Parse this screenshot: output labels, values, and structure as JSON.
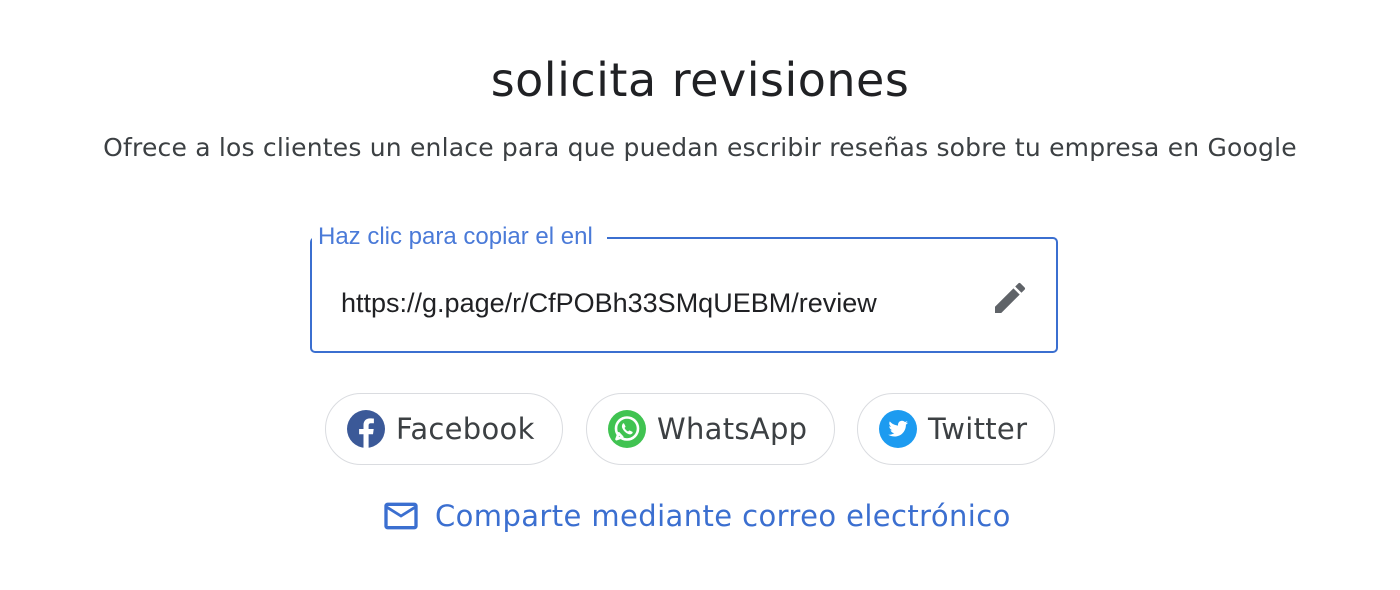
{
  "header": {
    "title": "solicita revisiones",
    "subtitle": "Ofrece a los clientes un enlace para que puedan escribir reseñas sobre tu empresa en Google"
  },
  "link_field": {
    "label": "Haz clic para copiar el enl",
    "value": "https://g.page/r/CfPOBh33SMqUEBM/review",
    "edit_icon": "pencil-icon"
  },
  "share": {
    "buttons": [
      {
        "label": "Facebook",
        "icon": "facebook-icon",
        "color": "#3b5998"
      },
      {
        "label": "WhatsApp",
        "icon": "whatsapp-icon",
        "color": "#40c351"
      },
      {
        "label": "Twitter",
        "icon": "twitter-icon",
        "color": "#1d9bf0"
      }
    ],
    "email_label": "Comparte mediante correo electrónico",
    "email_icon": "mail-icon"
  },
  "colors": {
    "accent": "#3b6fd0",
    "text_primary": "#202124",
    "text_secondary": "#3c4043",
    "border": "#dadce0"
  }
}
